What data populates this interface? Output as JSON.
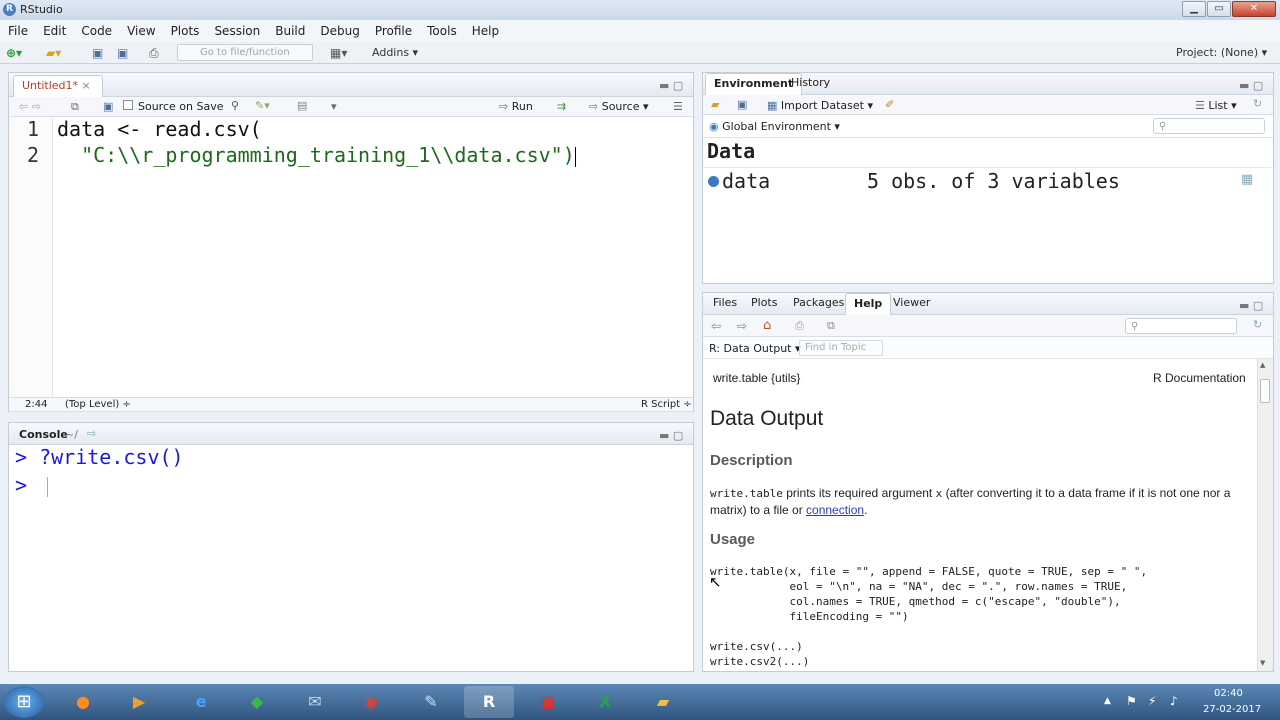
{
  "window": {
    "title": "RStudio",
    "min": "▁",
    "max": "▭",
    "close": "✕"
  },
  "menu": [
    "File",
    "Edit",
    "Code",
    "View",
    "Plots",
    "Session",
    "Build",
    "Debug",
    "Profile",
    "Tools",
    "Help"
  ],
  "toolbar": {
    "goto_placeholder": "Go to file/function",
    "addins": "Addins ▾",
    "project": "Project: (None) ▾"
  },
  "editor": {
    "tab_label": "Untitled1*",
    "tab_close": "×",
    "source_on_save": "Source on Save",
    "run": "Run",
    "source": "Source",
    "lines": [
      {
        "num": "1",
        "text": "data <- read.csv("
      },
      {
        "num": "2",
        "text": "  \"C:\\\\r_programming_training_1\\\\data.csv\")"
      }
    ],
    "status": {
      "position": "2:44",
      "level": "(Top Level) ÷",
      "type": "R Script ÷"
    }
  },
  "console": {
    "title": "Console",
    "path": "~/",
    "lines": [
      {
        "prompt": ">",
        "text": "?write.csv()"
      },
      {
        "prompt": ">",
        "text": ""
      }
    ]
  },
  "env": {
    "tabs": [
      "Environment",
      "History"
    ],
    "import": "Import Dataset ▾",
    "list": "List ▾",
    "scope": "Global Environment ▾",
    "section": "Data",
    "row": {
      "name": "data",
      "value": "5 obs. of 3 variables"
    }
  },
  "files": {
    "tabs": [
      "Files",
      "Plots",
      "Packages",
      "Help",
      "Viewer"
    ],
    "topic": "R: Data Output ▾",
    "find_placeholder": "Find in Topic"
  },
  "help": {
    "pkg": "write.table {utils}",
    "doc": "R Documentation",
    "title": "Data Output",
    "desc_heading": "Description",
    "desc_code1": "write.table",
    "desc_text1": " prints its required argument ",
    "desc_code2": "x",
    "desc_text2": " (after converting it to a data frame if it is not one nor a matrix) to a file or ",
    "desc_link": "connection",
    "desc_end": ".",
    "usage_heading": "Usage",
    "usage_lines": [
      "write.table(x, file = \"\", append = FALSE, quote = TRUE, sep = \" \",",
      "            eol = \"\\n\", na = \"NA\", dec = \".\", row.names = TRUE,",
      "            col.names = TRUE, qmethod = c(\"escape\", \"double\"),",
      "            fileEncoding = \"\")",
      "",
      "write.csv(...)",
      "write.csv2(...)"
    ]
  },
  "taskbar": {
    "time": "02:40",
    "date": "27-02-2017"
  },
  "colors": {
    "accent": "#2a5db0",
    "keyword": "#1b1bd6",
    "string": "#1b6b1b"
  }
}
